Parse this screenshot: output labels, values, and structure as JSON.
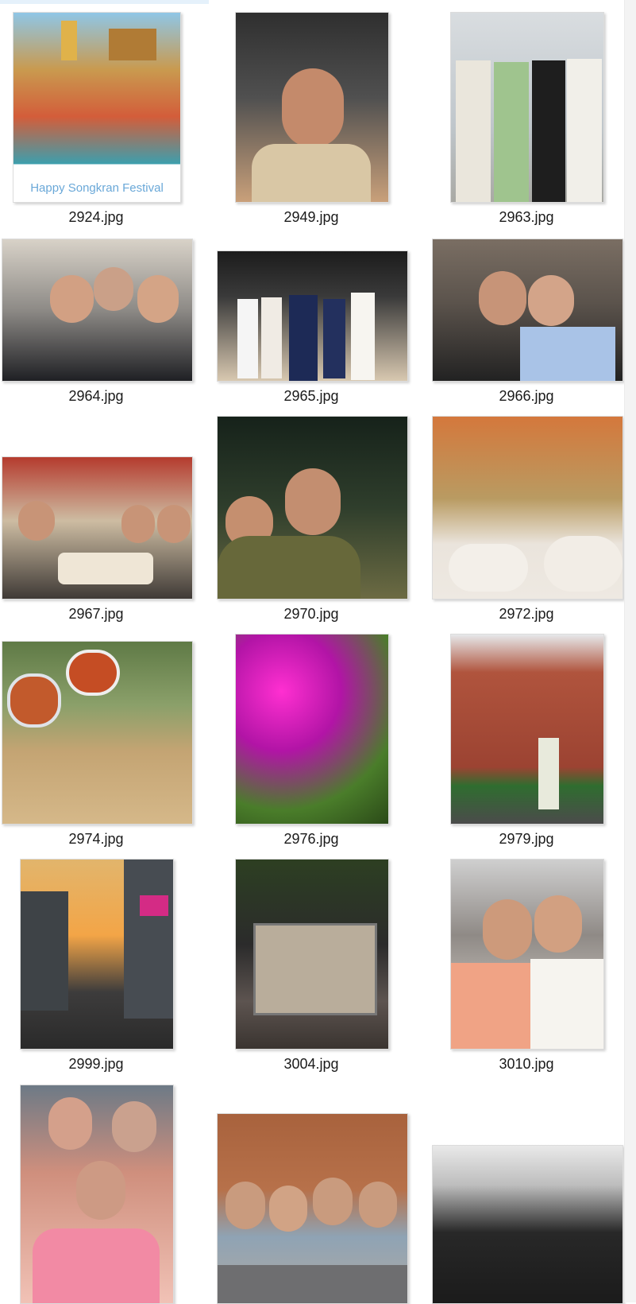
{
  "files": [
    {
      "name": "2924.jpg",
      "banner": "Happy Songkran Festival"
    },
    {
      "name": "2949.jpg"
    },
    {
      "name": "2963.jpg"
    },
    {
      "name": "2964.jpg"
    },
    {
      "name": "2965.jpg"
    },
    {
      "name": "2966.jpg"
    },
    {
      "name": "2967.jpg"
    },
    {
      "name": "2970.jpg"
    },
    {
      "name": "2972.jpg"
    },
    {
      "name": "2974.jpg"
    },
    {
      "name": "2976.jpg"
    },
    {
      "name": "2979.jpg"
    },
    {
      "name": "2999.jpg"
    },
    {
      "name": "3004.jpg"
    },
    {
      "name": "3010.jpg"
    },
    {
      "name": "",
      "caption_visible": false
    },
    {
      "name": "",
      "caption_visible": false
    },
    {
      "name": "",
      "caption_visible": false
    }
  ]
}
